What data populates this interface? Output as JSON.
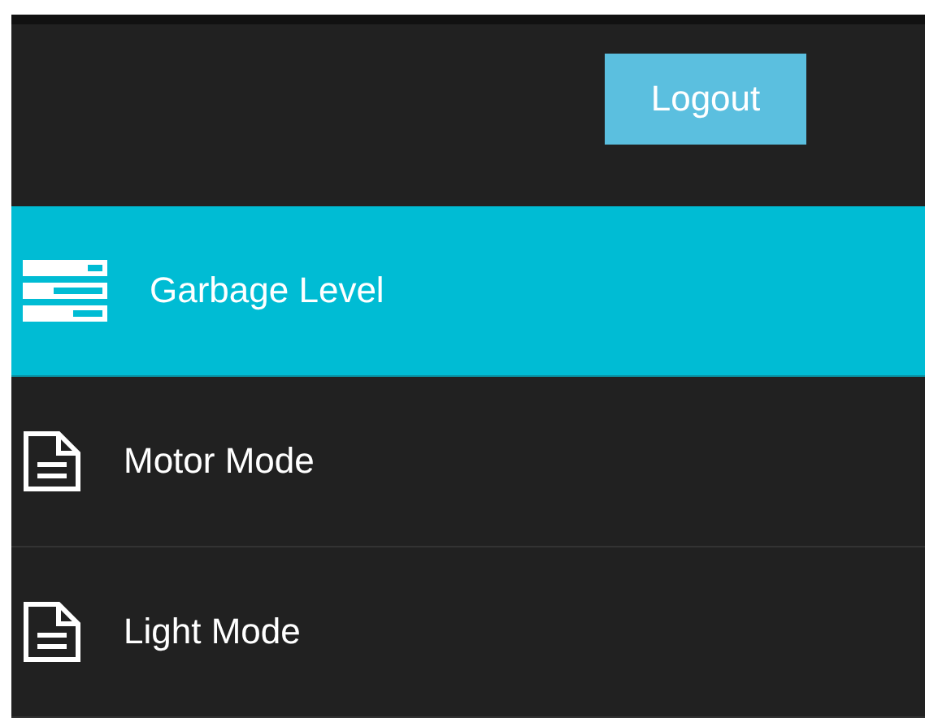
{
  "logout_button": {
    "label": "Logout"
  },
  "menu": [
    {
      "label": "Garbage Level",
      "kind": "summary",
      "selected": true
    },
    {
      "label": "Motor Mode",
      "kind": "page",
      "selected": false
    },
    {
      "label": "Light Mode",
      "kind": "page",
      "selected": false
    }
  ]
}
